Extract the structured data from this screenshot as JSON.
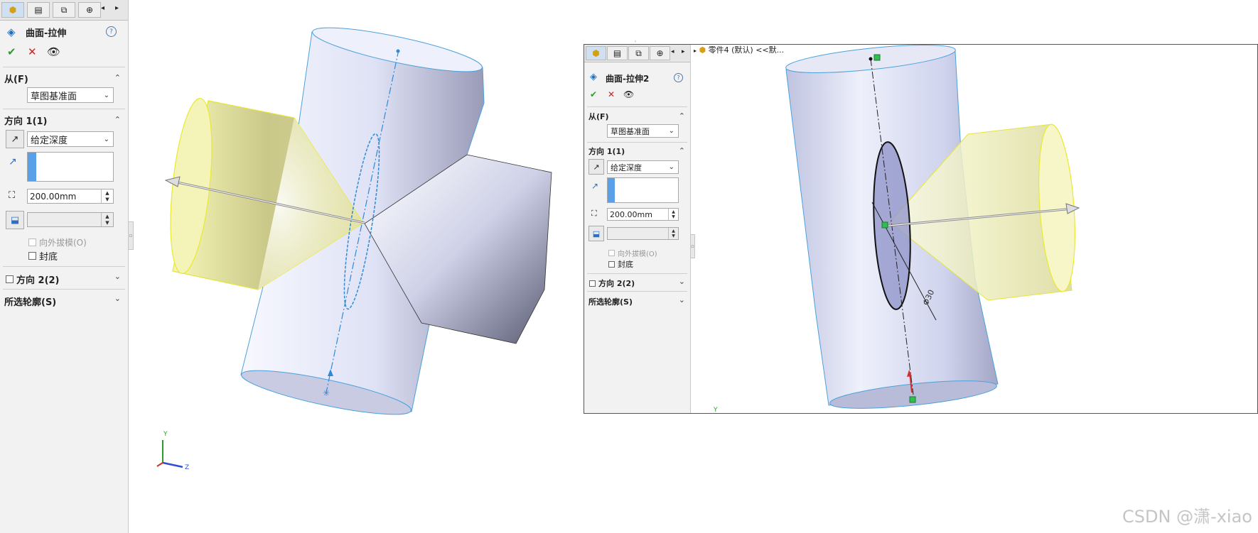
{
  "left_panel": {
    "tabs": [
      "feature-manager-icon",
      "property-manager-icon",
      "configuration-manager-icon",
      "dim-xpert-icon"
    ],
    "feature_title": "曲面-拉伸",
    "help_icon": "help-icon",
    "ok_icon": "check-icon",
    "cancel_icon": "close-icon",
    "preview_icon": "eye-icon",
    "from_section": {
      "label": "从(F)",
      "value": "草图基准面"
    },
    "direction1": {
      "label": "方向 1(1)",
      "end_condition": "给定深度",
      "depth": "200.00mm",
      "draft_outward": "向外拔模(O)",
      "cap_end": "封底"
    },
    "direction2": {
      "label": "方向 2(2)"
    },
    "selected_contours": {
      "label": "所选轮廓(S)"
    }
  },
  "right_panel": {
    "tree_crumb": "零件4 (默认) <<默...",
    "feature_title": "曲面-拉伸2",
    "from_section": {
      "label": "从(F)",
      "value": "草图基准面"
    },
    "direction1": {
      "label": "方向 1(1)",
      "end_condition": "给定深度",
      "depth": "200.00mm",
      "draft_outward": "向外拔模(O)",
      "cap_end": "封底"
    },
    "direction2": {
      "label": "方向 2(2)"
    },
    "selected_contours": {
      "label": "所选轮廓(S)"
    }
  },
  "triad": {
    "y": "Y",
    "z": "Z"
  },
  "right_axis_label": "Y",
  "watermark": "CSDN @潇-xiao",
  "colors": {
    "surface_blue": "#c9cde8",
    "surface_yellow": "#e9e9a8",
    "sketch_blue": "#2f8ad6",
    "accent_blue": "#5aa0e8"
  }
}
